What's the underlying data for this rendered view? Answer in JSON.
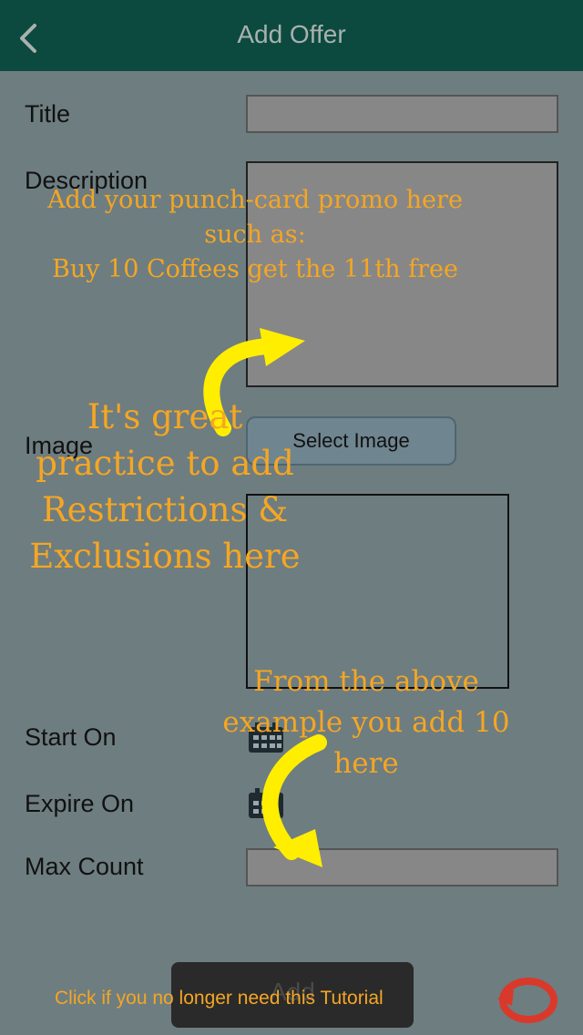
{
  "header": {
    "title": "Add Offer",
    "back_icon": "chevron-left-icon"
  },
  "form": {
    "title_label": "Title",
    "description_label": "Description",
    "image_label": "Image",
    "select_image_label": "Select Image",
    "start_label": "Start On",
    "expire_label": "Expire On",
    "max_count_label": "Max Count",
    "add_label": "Add",
    "calendar_icon": "calendar-icon"
  },
  "tutorial": {
    "promo_line1": "Add your punch-card promo here",
    "promo_line2": "such as:",
    "promo_line3": "Buy 10 Coffees get the 11th free",
    "restrict_line1": "It's great",
    "restrict_line2": "practice to add",
    "restrict_line3": "Restrictions &",
    "restrict_line4": "Exclusions here",
    "count_line1": "From the above",
    "count_line2": "example you add 10",
    "count_line3": "here",
    "dismiss_text": "Click if you no longer need this Tutorial",
    "dismiss_icon": "close-circle-icon"
  },
  "colors": {
    "header_bg": "#0c4a3f",
    "overlay_text": "#f5a623",
    "arrow": "#ffee00",
    "dismiss_icon": "#d9392b"
  }
}
